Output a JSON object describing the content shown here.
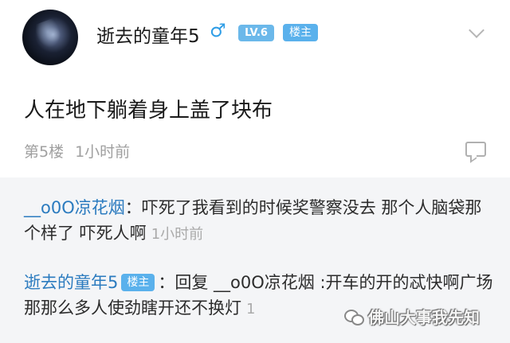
{
  "post": {
    "author": "逝去的童年5",
    "gender_icon": "♂",
    "level": "LV.6",
    "op_badge": "楼主",
    "content": "人在地下躺着身上盖了块布",
    "floor": "第5楼",
    "time": "1小时前"
  },
  "replies": [
    {
      "name": "__o0O凉花烟",
      "separator": "：",
      "text": "吓死了我看到的时候奖警察没去 那个人脑袋那个样了 吓死人啊",
      "time": "1小时前"
    },
    {
      "name": "逝去的童年5",
      "badge": "楼主",
      "separator": "：",
      "text": "回复 __o0O凉花烟 :开车的开的忒快啊广场那那么多人使劲瞎开还不换灯",
      "time": "1"
    }
  ],
  "watermark": "佛山大事我先知",
  "colors": {
    "name_link": "#2b7bbf",
    "badge": "#5ab1ec",
    "gender_icon": "#2e9de6",
    "reply_background": "#f4f5f7"
  },
  "icons": {
    "chevron": "chevron-down-icon",
    "comment": "comment-icon",
    "gender": "male-icon"
  }
}
